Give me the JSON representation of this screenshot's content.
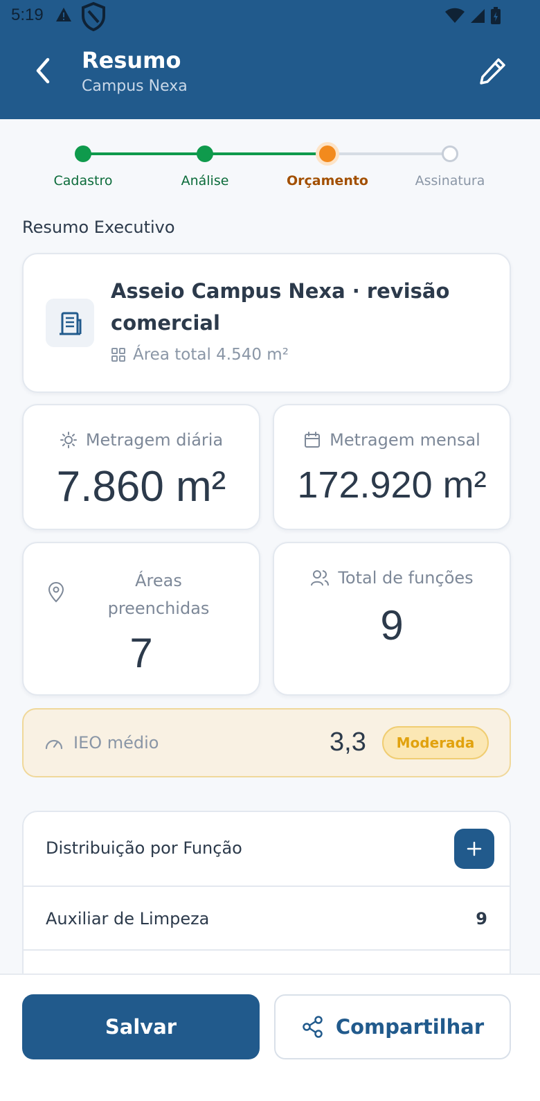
{
  "status_bar": {
    "time": "5:19"
  },
  "header": {
    "title": "Resumo",
    "subtitle": "Campus Nexa"
  },
  "stepper": {
    "steps": [
      {
        "label": "Cadastro",
        "state": "done"
      },
      {
        "label": "Análise",
        "state": "done"
      },
      {
        "label": "Orçamento",
        "state": "current"
      },
      {
        "label": "Assinatura",
        "state": "pending"
      }
    ]
  },
  "summary": {
    "section_title": "Resumo Executivo",
    "project_name": "Asseio Campus Nexa · revisão comercial",
    "total_area": "Área total 4.540 m²"
  },
  "stats": {
    "daily": {
      "label": "Metragem diária",
      "value": "7.860 m²",
      "icon": "sun-icon"
    },
    "monthly": {
      "label": "Metragem mensal",
      "value": "172.920 m²",
      "icon": "calendar-icon"
    },
    "areas": {
      "label": "Áreas preenchidas",
      "value": "7",
      "icon": "map-pin-icon"
    },
    "functions": {
      "label": "Total de funções",
      "value": "9",
      "icon": "users-icon"
    }
  },
  "ieo": {
    "label": "IEO médio",
    "value": "3,3",
    "badge": "Moderada"
  },
  "distribution": {
    "title": "Distribuição por Função",
    "rows": [
      {
        "label": "Auxiliar de Limpeza",
        "count": "9"
      }
    ]
  },
  "actions": {
    "save": "Salvar",
    "share": "Compartilhar"
  },
  "colors": {
    "primary": "#215a8c",
    "done": "#0f9a4c",
    "current": "#f28a1d",
    "pending": "#c7ced8",
    "badge_text": "#e1a20e"
  }
}
